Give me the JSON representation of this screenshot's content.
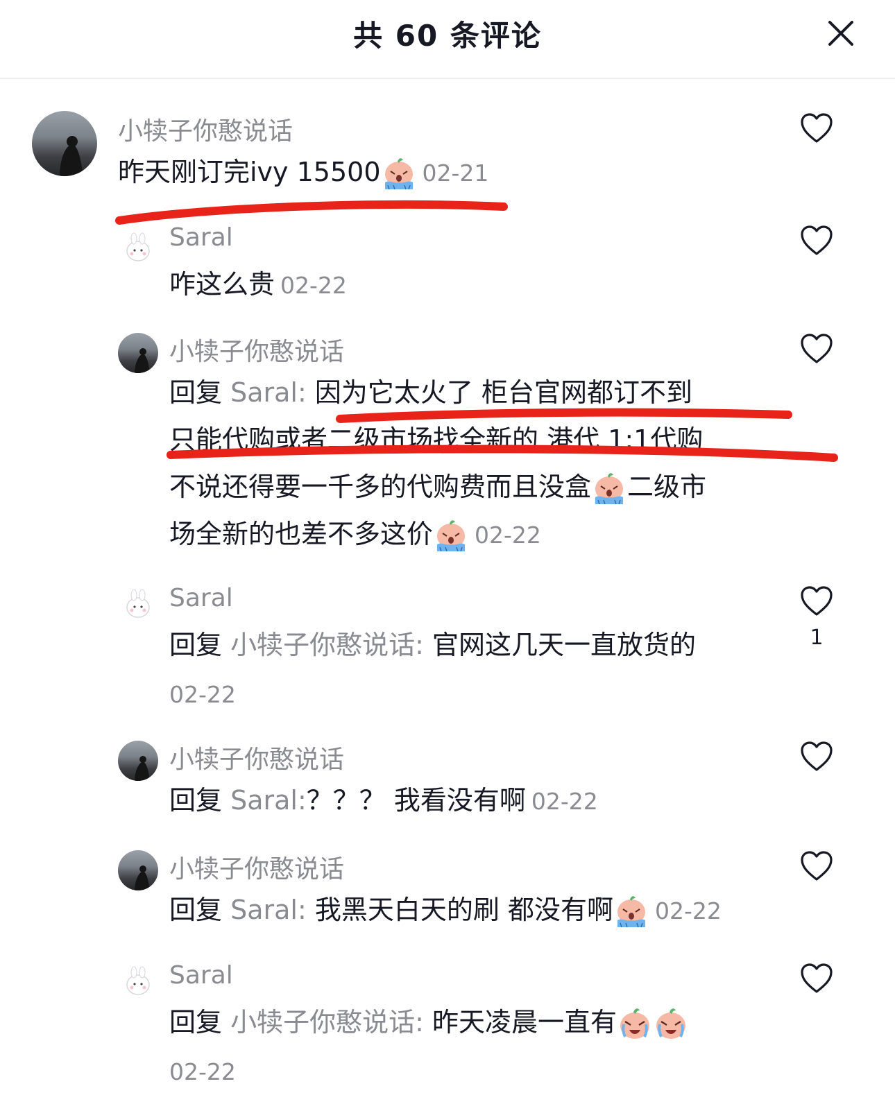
{
  "header": {
    "title": "共 60 条评论"
  },
  "comments": [
    {
      "user": "小犊子你憨说话",
      "text": "昨天刚订完ivy 15500",
      "date": "02-21"
    },
    {
      "user": "Saral",
      "text": "咋这么贵",
      "date": "02-22"
    },
    {
      "user": "小犊子你憨说话",
      "reply_prefix": "回复 ",
      "reply_target": "Saral:",
      "lines": [
        " 因为它太火了 柜台官网都订不到",
        "只能代购或者二级市场找全新的 港代 1:1代购",
        "不说还得要一千多的代购费而且没盒",
        "二级市",
        "场全新的也差不多这价"
      ],
      "date": "02-22"
    },
    {
      "user": "Saral",
      "reply_prefix": "回复 ",
      "reply_target": "小犊子你憨说话:",
      "text": " 官网这几天一直放货的",
      "date": "02-22",
      "likes": "1"
    },
    {
      "user": "小犊子你憨说话",
      "reply_prefix": "回复 ",
      "reply_target": "Saral:",
      "text": "？？？ 我看没有啊",
      "date": "02-22"
    },
    {
      "user": "小犊子你憨说话",
      "reply_prefix": "回复 ",
      "reply_target": "Saral:",
      "text": " 我黑天白天的刷 都没有啊",
      "date": "02-22"
    },
    {
      "user": "Saral",
      "reply_prefix": "回复 ",
      "reply_target": "小犊子你憨说话:",
      "text": " 昨天凌晨一直有",
      "date": "02-22"
    }
  ]
}
